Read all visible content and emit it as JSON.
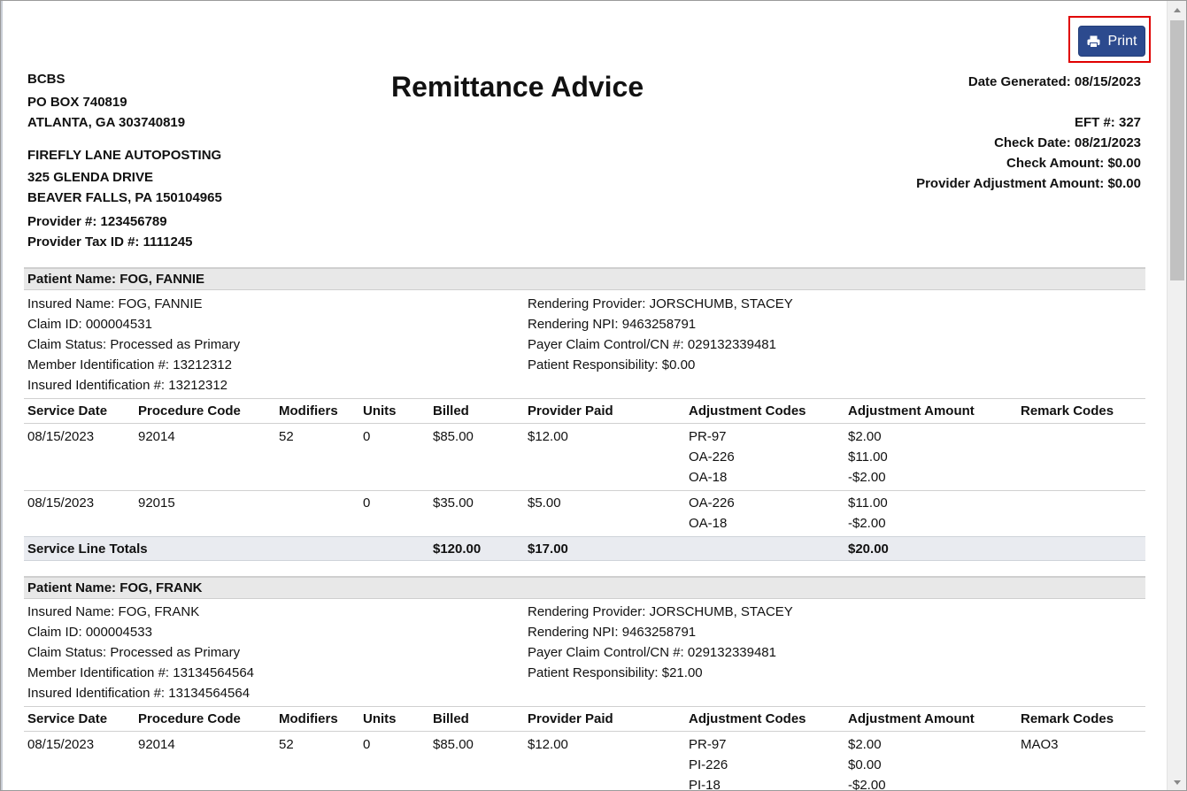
{
  "toolbar": {
    "print_label": "Print"
  },
  "title": "Remittance Advice",
  "payer": {
    "name": "BCBS",
    "address1": "PO BOX 740819",
    "address2": "ATLANTA, GA 303740819"
  },
  "provider": {
    "name": "FIREFLY LANE AUTOPOSTING",
    "address1": "325 GLENDA DRIVE",
    "address2": "BEAVER FALLS, PA 150104965",
    "provider_number": "Provider #: 123456789",
    "tax_id": "Provider Tax ID #: 1111245"
  },
  "summary": {
    "date_generated": "Date Generated: 08/15/2023",
    "eft": "EFT #: 327",
    "check_date": "Check Date: 08/21/2023",
    "check_amount": "Check Amount: $0.00",
    "provider_adjustment": "Provider Adjustment Amount: $0.00"
  },
  "table_headers": {
    "service_date": "Service Date",
    "procedure_code": "Procedure Code",
    "modifiers": "Modifiers",
    "units": "Units",
    "billed": "Billed",
    "provider_paid": "Provider Paid",
    "adjustment_codes": "Adjustment Codes",
    "adjustment_amount": "Adjustment Amount",
    "remark_codes": "Remark Codes"
  },
  "patients": [
    {
      "header": "Patient Name: FOG, FANNIE",
      "left": [
        "Insured Name: FOG, FANNIE",
        "Claim ID: 000004531",
        "Claim Status: Processed as Primary",
        "Member Identification #: 13212312",
        "Insured Identification #: 13212312"
      ],
      "right": [
        "Rendering Provider: JORSCHUMB, STACEY",
        "Rendering NPI: 9463258791",
        "Payer Claim Control/CN #: 029132339481",
        "Patient Responsibility: $0.00"
      ],
      "rows": [
        {
          "service_date": "08/15/2023",
          "procedure_code": "92014",
          "modifiers": "52",
          "units": "0",
          "billed": "$85.00",
          "provider_paid": "$12.00",
          "adjustment_codes": [
            "PR-97",
            "OA-226",
            "OA-18"
          ],
          "adjustment_amounts": [
            "$2.00",
            "$11.00",
            "-$2.00"
          ],
          "remark_codes": ""
        },
        {
          "service_date": "08/15/2023",
          "procedure_code": "92015",
          "modifiers": "",
          "units": "0",
          "billed": "$35.00",
          "provider_paid": "$5.00",
          "adjustment_codes": [
            "OA-226",
            "OA-18"
          ],
          "adjustment_amounts": [
            "$11.00",
            "-$2.00"
          ],
          "remark_codes": ""
        }
      ],
      "totals": {
        "label": "Service Line Totals",
        "billed": "$120.00",
        "provider_paid": "$17.00",
        "adjustment_amount": "$20.00"
      }
    },
    {
      "header": "Patient Name: FOG, FRANK",
      "left": [
        "Insured Name: FOG, FRANK",
        "Claim ID: 000004533",
        "Claim Status: Processed as Primary",
        "Member Identification #: 13134564564",
        "Insured Identification #: 13134564564"
      ],
      "right": [
        "Rendering Provider: JORSCHUMB, STACEY",
        "Rendering NPI: 9463258791",
        "Payer Claim Control/CN #: 029132339481",
        "Patient Responsibility: $21.00"
      ],
      "rows": [
        {
          "service_date": "08/15/2023",
          "procedure_code": "92014",
          "modifiers": "52",
          "units": "0",
          "billed": "$85.00",
          "provider_paid": "$12.00",
          "adjustment_codes": [
            "PR-97",
            "PI-226",
            "PI-18"
          ],
          "adjustment_amounts": [
            "$2.00",
            "$0.00",
            "-$2.00"
          ],
          "remark_codes": "MAO3"
        }
      ]
    }
  ]
}
